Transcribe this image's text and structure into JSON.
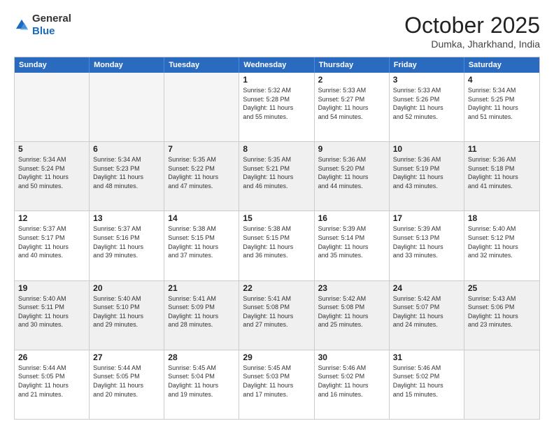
{
  "header": {
    "logo": {
      "general": "General",
      "blue": "Blue"
    },
    "title": "October 2025",
    "location": "Dumka, Jharkhand, India"
  },
  "weekdays": [
    "Sunday",
    "Monday",
    "Tuesday",
    "Wednesday",
    "Thursday",
    "Friday",
    "Saturday"
  ],
  "rows": [
    [
      {
        "day": "",
        "info": ""
      },
      {
        "day": "",
        "info": ""
      },
      {
        "day": "",
        "info": ""
      },
      {
        "day": "1",
        "info": "Sunrise: 5:32 AM\nSunset: 5:28 PM\nDaylight: 11 hours\nand 55 minutes."
      },
      {
        "day": "2",
        "info": "Sunrise: 5:33 AM\nSunset: 5:27 PM\nDaylight: 11 hours\nand 54 minutes."
      },
      {
        "day": "3",
        "info": "Sunrise: 5:33 AM\nSunset: 5:26 PM\nDaylight: 11 hours\nand 52 minutes."
      },
      {
        "day": "4",
        "info": "Sunrise: 5:34 AM\nSunset: 5:25 PM\nDaylight: 11 hours\nand 51 minutes."
      }
    ],
    [
      {
        "day": "5",
        "info": "Sunrise: 5:34 AM\nSunset: 5:24 PM\nDaylight: 11 hours\nand 50 minutes."
      },
      {
        "day": "6",
        "info": "Sunrise: 5:34 AM\nSunset: 5:23 PM\nDaylight: 11 hours\nand 48 minutes."
      },
      {
        "day": "7",
        "info": "Sunrise: 5:35 AM\nSunset: 5:22 PM\nDaylight: 11 hours\nand 47 minutes."
      },
      {
        "day": "8",
        "info": "Sunrise: 5:35 AM\nSunset: 5:21 PM\nDaylight: 11 hours\nand 46 minutes."
      },
      {
        "day": "9",
        "info": "Sunrise: 5:36 AM\nSunset: 5:20 PM\nDaylight: 11 hours\nand 44 minutes."
      },
      {
        "day": "10",
        "info": "Sunrise: 5:36 AM\nSunset: 5:19 PM\nDaylight: 11 hours\nand 43 minutes."
      },
      {
        "day": "11",
        "info": "Sunrise: 5:36 AM\nSunset: 5:18 PM\nDaylight: 11 hours\nand 41 minutes."
      }
    ],
    [
      {
        "day": "12",
        "info": "Sunrise: 5:37 AM\nSunset: 5:17 PM\nDaylight: 11 hours\nand 40 minutes."
      },
      {
        "day": "13",
        "info": "Sunrise: 5:37 AM\nSunset: 5:16 PM\nDaylight: 11 hours\nand 39 minutes."
      },
      {
        "day": "14",
        "info": "Sunrise: 5:38 AM\nSunset: 5:15 PM\nDaylight: 11 hours\nand 37 minutes."
      },
      {
        "day": "15",
        "info": "Sunrise: 5:38 AM\nSunset: 5:15 PM\nDaylight: 11 hours\nand 36 minutes."
      },
      {
        "day": "16",
        "info": "Sunrise: 5:39 AM\nSunset: 5:14 PM\nDaylight: 11 hours\nand 35 minutes."
      },
      {
        "day": "17",
        "info": "Sunrise: 5:39 AM\nSunset: 5:13 PM\nDaylight: 11 hours\nand 33 minutes."
      },
      {
        "day": "18",
        "info": "Sunrise: 5:40 AM\nSunset: 5:12 PM\nDaylight: 11 hours\nand 32 minutes."
      }
    ],
    [
      {
        "day": "19",
        "info": "Sunrise: 5:40 AM\nSunset: 5:11 PM\nDaylight: 11 hours\nand 30 minutes."
      },
      {
        "day": "20",
        "info": "Sunrise: 5:40 AM\nSunset: 5:10 PM\nDaylight: 11 hours\nand 29 minutes."
      },
      {
        "day": "21",
        "info": "Sunrise: 5:41 AM\nSunset: 5:09 PM\nDaylight: 11 hours\nand 28 minutes."
      },
      {
        "day": "22",
        "info": "Sunrise: 5:41 AM\nSunset: 5:08 PM\nDaylight: 11 hours\nand 27 minutes."
      },
      {
        "day": "23",
        "info": "Sunrise: 5:42 AM\nSunset: 5:08 PM\nDaylight: 11 hours\nand 25 minutes."
      },
      {
        "day": "24",
        "info": "Sunrise: 5:42 AM\nSunset: 5:07 PM\nDaylight: 11 hours\nand 24 minutes."
      },
      {
        "day": "25",
        "info": "Sunrise: 5:43 AM\nSunset: 5:06 PM\nDaylight: 11 hours\nand 23 minutes."
      }
    ],
    [
      {
        "day": "26",
        "info": "Sunrise: 5:44 AM\nSunset: 5:05 PM\nDaylight: 11 hours\nand 21 minutes."
      },
      {
        "day": "27",
        "info": "Sunrise: 5:44 AM\nSunset: 5:05 PM\nDaylight: 11 hours\nand 20 minutes."
      },
      {
        "day": "28",
        "info": "Sunrise: 5:45 AM\nSunset: 5:04 PM\nDaylight: 11 hours\nand 19 minutes."
      },
      {
        "day": "29",
        "info": "Sunrise: 5:45 AM\nSunset: 5:03 PM\nDaylight: 11 hours\nand 17 minutes."
      },
      {
        "day": "30",
        "info": "Sunrise: 5:46 AM\nSunset: 5:02 PM\nDaylight: 11 hours\nand 16 minutes."
      },
      {
        "day": "31",
        "info": "Sunrise: 5:46 AM\nSunset: 5:02 PM\nDaylight: 11 hours\nand 15 minutes."
      },
      {
        "day": "",
        "info": ""
      }
    ]
  ]
}
